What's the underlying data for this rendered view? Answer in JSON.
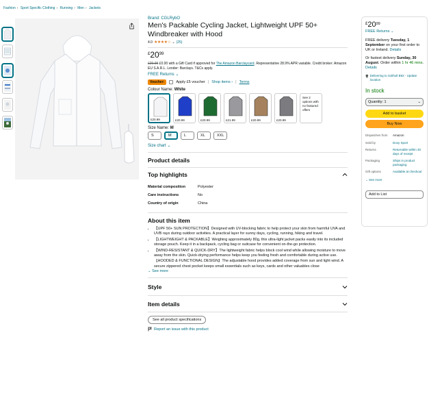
{
  "breadcrumb": [
    "Fashion",
    "Sport Specific Clothing",
    "Running",
    "Men",
    "Jackets"
  ],
  "product": {
    "brand": "Brand: CGLRybO",
    "title": "Men's Packable Cycling Jacket, Lightweight UPF 50+ Windbreaker with Hood",
    "rating_value": "4.0",
    "rating_count": "(25)",
    "price_symbol": "£",
    "price_whole": "20",
    "price_fraction": "99",
    "promo_strike": "£20.99",
    "promo_text_1": " £0.00 with a Gift Card if approved for ",
    "promo_link": "The Amazon Barclaycard",
    "promo_text_2": ". Representative 28.9% APR variable. Credit broker: Amazon EU S.A.R.L. Lender: Barclays. T&Cs apply.",
    "free_returns": "FREE Returns",
    "voucher_badge": "Voucher:",
    "voucher_text": "Apply £5 voucher",
    "shop_items": "Shop items ›",
    "terms": "Terms",
    "colour_label": "Colour Name:",
    "colour_value": "White",
    "swatches": [
      {
        "price": "£20.99",
        "color": "#f4f4f6"
      },
      {
        "price": "£20.99",
        "color": "#1f3fc8"
      },
      {
        "price": "£20.99",
        "color": "#1e6b32"
      },
      {
        "price": "£21.99",
        "color": "#9a9a9e"
      },
      {
        "price": "£20.99",
        "color": "#a5825d"
      },
      {
        "price": "£20.99",
        "color": "#7b7b80"
      }
    ],
    "swatch_note": "See 2 options with no featured offers",
    "size_label": "Size Name:",
    "size_value": "M",
    "sizes": [
      "S",
      "M",
      "L",
      "XL",
      "XXL"
    ],
    "size_chart": "Size chart"
  },
  "details": {
    "section_title": "Product details",
    "highlights_title": "Top highlights",
    "specs": [
      {
        "key": "Material composition",
        "value": "Polyester"
      },
      {
        "key": "Care instructions",
        "value": "No"
      },
      {
        "key": "Country of origin",
        "value": "China"
      }
    ],
    "about_title": "About this item",
    "about_items": [
      "【UPF 50+ SUN PROTECTION】Designed with UV-blocking fabric to help protect your skin from harmful UVA and UVB rays during outdoor activities. A practical layer for sunny days, cycling, running, hiking and travel.",
      "【LIGHTWEIGHT & PACKABLE】Weighing approximately 80g, this ultra-light jacket packs easily into its included storage pouch. Keep it in a backpack, cycling bag or suitcase for convenient on-the-go protection.",
      "【WIND-RESISTANT & QUICK-DRY】The lightweight fabric helps block cool wind while allowing moisture to move away from the skin. Quick-drying performance helps keep you feeling fresh and comfortable during active use.",
      "【HOODED & FUNCTIONAL DESIGN】The adjustable hood provides added coverage from sun and light wind. A secure zippered chest pocket keeps small essentials such as keys, cards and other valuables close"
    ],
    "see_more": "See more",
    "style_title": "Style",
    "item_details_title": "Item details",
    "see_all_specs": "See all product specifications",
    "report_issue": "Report an issue with this product"
  },
  "buybox": {
    "price_symbol": "£",
    "price_whole": "20",
    "price_fraction": "99",
    "free_returns": "FREE Returns",
    "delivery_1": "FREE delivery ",
    "delivery_day": "Tuesday, 1 September",
    "delivery_2": " on your first order to UK or Ireland. ",
    "details_link": "Details",
    "fastest_1": "Or fastest delivery ",
    "fastest_day": "Sunday, 30 August",
    "fastest_2": ". Order within ",
    "fastest_time": "1 hr 46 mins",
    "fastest_3": ". ",
    "location": "Delivering to Solihull B92 - Update location",
    "stock": "In stock",
    "quantity": "Quantity: 1",
    "add_to_basket": "Add to basket",
    "buy_now": "Buy Now",
    "info": [
      {
        "key": "Dispatches from",
        "value": "Amazon",
        "link": false
      },
      {
        "key": "Sold by",
        "value": "Doxy Sport",
        "link": true
      },
      {
        "key": "Returns",
        "value": "Returnable within 30 days of receipt",
        "link": true
      },
      {
        "key": "Packaging",
        "value": "Ships in product packaging",
        "link": true
      },
      {
        "key": "Gift options",
        "value": "Available at checkout",
        "link": true
      }
    ],
    "see_more": "See more",
    "add_to_list": "Add to List"
  }
}
